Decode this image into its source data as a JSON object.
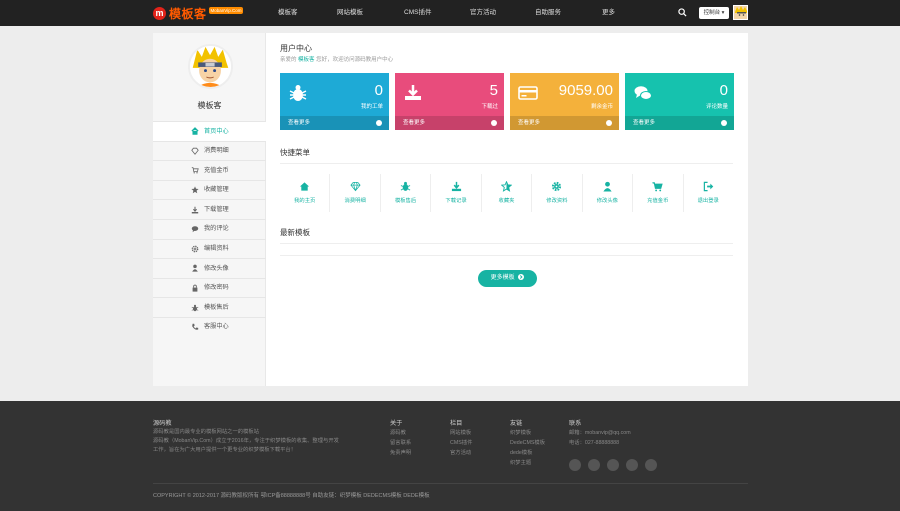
{
  "brand": {
    "logo_letter": "m",
    "name": "模板客",
    "badge": "MobanVip.Com"
  },
  "nav": {
    "items": [
      "模板客",
      "网站模板",
      "CMS插件",
      "官方活动",
      "自助服务",
      "更多"
    ],
    "console": "控制台 ▾"
  },
  "sidebar": {
    "username": "模板客",
    "items": [
      {
        "label": "首页中心",
        "icon": "home-icon",
        "active": true
      },
      {
        "label": "消费明细",
        "icon": "diamond-icon"
      },
      {
        "label": "充值金币",
        "icon": "cart-icon"
      },
      {
        "label": "收藏管理",
        "icon": "star-icon"
      },
      {
        "label": "下载管理",
        "icon": "download-icon"
      },
      {
        "label": "我的评论",
        "icon": "comment-icon"
      },
      {
        "label": "编辑资料",
        "icon": "gear-icon"
      },
      {
        "label": "修改头像",
        "icon": "user-icon"
      },
      {
        "label": "修改密码",
        "icon": "lock-icon"
      },
      {
        "label": "模板售后",
        "icon": "bug-icon"
      },
      {
        "label": "客服中心",
        "icon": "phone-icon"
      }
    ]
  },
  "main": {
    "title": "用户中心",
    "welcome_pre": "亲爱的",
    "welcome_user": "模板客",
    "welcome_post": "您好，欢迎访问源码教用户中心",
    "stats": [
      {
        "value": "0",
        "label": "我的工单",
        "foot": "查看更多",
        "color": "#1eaad6",
        "icon": "bug-icon"
      },
      {
        "value": "5",
        "label": "下载过",
        "foot": "查看更多",
        "color": "#e84c7c",
        "icon": "download-icon"
      },
      {
        "value": "9059.00",
        "label": "剩余金币",
        "foot": "查看更多",
        "color": "#f4b13b",
        "icon": "card-icon"
      },
      {
        "value": "0",
        "label": "评论数量",
        "foot": "查看更多",
        "color": "#16c2ae",
        "icon": "comments-icon"
      }
    ],
    "quick_title": "快捷菜单",
    "quick": [
      {
        "label": "我的主页",
        "icon": "home-icon"
      },
      {
        "label": "消费明细",
        "icon": "diamond-icon"
      },
      {
        "label": "模板售后",
        "icon": "bug-icon"
      },
      {
        "label": "下载记录",
        "icon": "download-icon"
      },
      {
        "label": "收藏夹",
        "icon": "star-icon"
      },
      {
        "label": "修改资料",
        "icon": "gear-icon"
      },
      {
        "label": "修改头像",
        "icon": "user-icon"
      },
      {
        "label": "充值金币",
        "icon": "cart-icon"
      },
      {
        "label": "退出登录",
        "icon": "logout-icon"
      }
    ],
    "latest_title": "最新模板",
    "more_button": "更多模板"
  },
  "footer": {
    "about_title": "源码教",
    "about_lines": [
      "源码教是国内最专业的模板网站之一的模板站",
      "源码教（MobanVip.Com）成立于2016年，专注于织梦模板的收集、整理与开发",
      "工作，旨在为广大用户提供一个更专业的织梦模板下载平台！"
    ],
    "col1_title": "关于",
    "col1": [
      "源码教",
      "留言联系",
      "免责声明"
    ],
    "col2_title": "栏目",
    "col2": [
      "网站模板",
      "CMS插件",
      "官方活动"
    ],
    "col3_title": "友链",
    "col3": [
      "织梦模板",
      "DedeCMS模板",
      "dede模板",
      "织梦主题"
    ],
    "col4_title": "联系",
    "col4": [
      "邮箱：mobanvip@qq.com",
      "电话：027-88888888"
    ],
    "copyright": "COPYRIGHT © 2012-2017 源码教版权所有 鄂ICP备88888888号 自助友链：织梦模板  DEDECMS模板  DEDE模板"
  },
  "colors": {
    "accent": "#17b3a3",
    "topbar": "#222222",
    "footer": "#333333"
  }
}
